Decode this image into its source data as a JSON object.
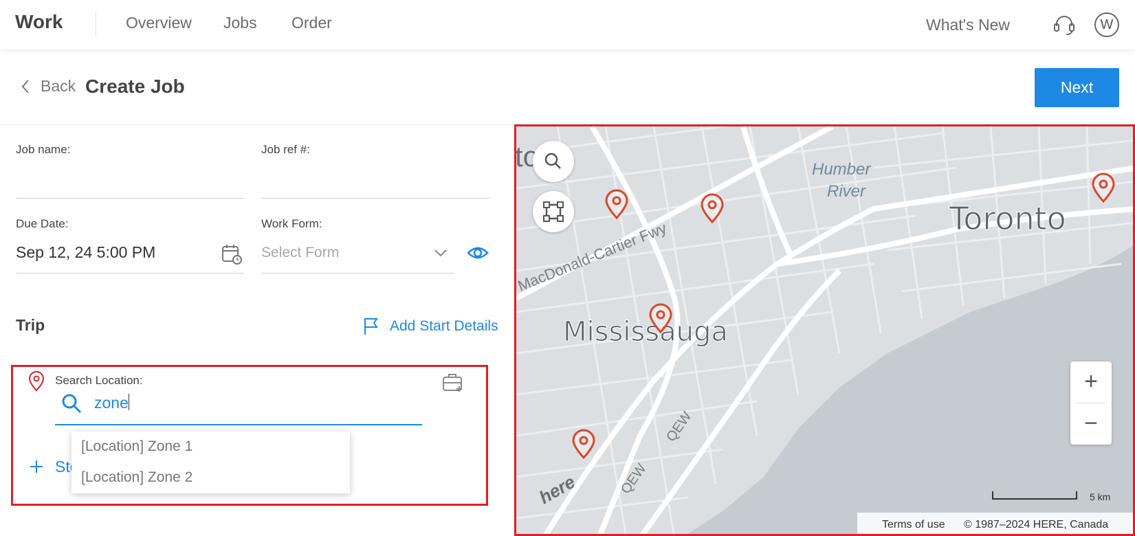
{
  "topbar": {
    "brand": "Work",
    "nav": [
      "Overview",
      "Jobs",
      "Order"
    ],
    "whats_new": "What's New",
    "avatar_initial": "W",
    "icons": {
      "support": "headset-icon",
      "avatar": "avatar"
    }
  },
  "header": {
    "back_label": "Back",
    "title": "Create Job",
    "next_label": "Next"
  },
  "form": {
    "job_name_label": "Job name:",
    "job_name_value": "",
    "job_ref_label": "Job ref #:",
    "job_ref_value": "",
    "due_date_label": "Due Date:",
    "due_date_value": "Sep 12, 24 5:00 PM",
    "work_form_label": "Work Form:",
    "work_form_placeholder": "Select Form"
  },
  "trip": {
    "title": "Trip",
    "add_start_label": "Add Start Details",
    "search_location_label": "Search Location:",
    "search_value": "zone",
    "add_stop_label": "Stop",
    "suggestions": [
      "[Location] Zone 1",
      "[Location] Zone 2"
    ]
  },
  "map": {
    "labels": {
      "city_1": "Toronto",
      "city_2": "Mississauga",
      "river": "Humber",
      "river_2": "River",
      "highway_1": "MacDonald-Cartier Fwy",
      "highway_2": "QEW",
      "partial": "to",
      "logo": "here"
    },
    "scale_label": "5 km",
    "terms_label": "Terms of use",
    "copyright": "© 1987–2024 HERE, Canada",
    "zoom_in": "+",
    "zoom_out": "−",
    "pin_color": "#d9472b",
    "land_color": "#dcdfe2",
    "water_color": "#c4cbd1"
  },
  "colors": {
    "accent": "#1e88e5",
    "highlight_border": "#e01e26"
  }
}
